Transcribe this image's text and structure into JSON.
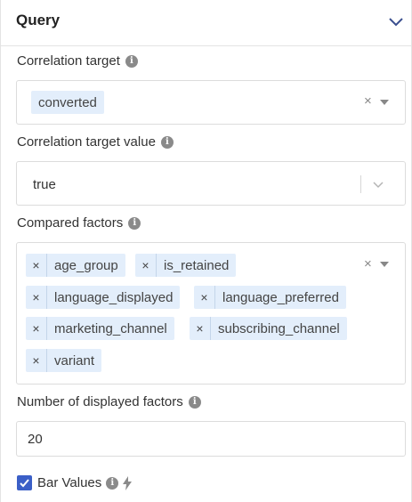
{
  "header": {
    "title": "Query"
  },
  "correlation_target": {
    "label": "Correlation target",
    "selected": "converted"
  },
  "correlation_target_value": {
    "label": "Correlation target value",
    "value": "true"
  },
  "compared_factors": {
    "label": "Compared factors",
    "chips": [
      "age_group",
      "is_retained",
      "language_displayed",
      "language_preferred",
      "marketing_channel",
      "subscribing_channel",
      "variant"
    ]
  },
  "displayed_factors": {
    "label": "Number of displayed factors",
    "value": "20"
  },
  "bar_values": {
    "label": "Bar Values",
    "checked": true
  },
  "icons": {
    "chip_remove": "×",
    "clear": "×",
    "info": "i"
  },
  "colors": {
    "chip_bg": "#e3eefb",
    "checkbox": "#3b5fc7",
    "chevron": "#3b4f8f"
  }
}
